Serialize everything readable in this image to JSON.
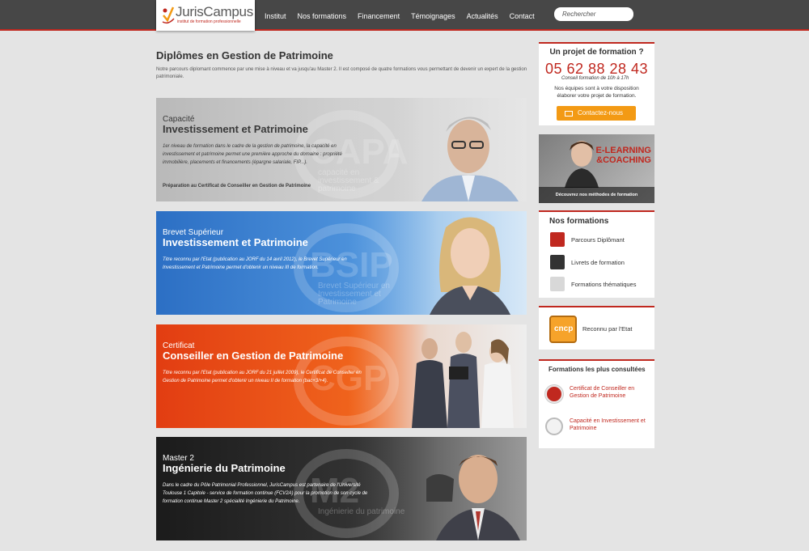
{
  "header": {
    "brand": "JurisCampus",
    "tagline": "institut de formation professionnelle",
    "nav": [
      "Institut",
      "Nos formations",
      "Financement",
      "Témoignages",
      "Actualités",
      "Contact"
    ],
    "search_placeholder": "Rechercher"
  },
  "page": {
    "title": "Diplômes en Gestion de Patrimoine",
    "intro": "Notre parcours diplomant commence par une mise à niveau et va jusqu'au Master 2. Il est composé de quatre formations vous permettant de devenir un expert de la gestion patrimoniale."
  },
  "banners": [
    {
      "sub": "Capacité",
      "main": "Investissement et Patrimoine",
      "desc": "1er niveau de formation dans le cadre de la gestion de patrimoine, la capacité en investissement et patrimoine permet une première approche du domaine : propriété immobilière, placements et financements (épargne salariale, FIP...).",
      "extra": "Préparation au Certificat de Conseiller en Gestion de Patrimoine",
      "ghost": "CAPA",
      "ghost_sub": "capacité en investissement & patrimoine"
    },
    {
      "sub": "Brevet Supérieur",
      "main": "Investissement et Patrimoine",
      "desc": "Titre reconnu par l'Etat (publication au JORF du 14 avril 2012), le Brevet Supérieur en Investissement et Patrimoine permet d'obtenir un niveau III de formation.",
      "ghost": "BSIP",
      "ghost_sub": "Brevet Supérieur en Investissement et Patrimoine"
    },
    {
      "sub": "Certificat",
      "main": "Conseiller en Gestion de Patrimoine",
      "desc": "Titre reconnu par l'Etat (publication au JORF du 21 juillet 2009), le Certificat de Conseiller en Gestion de Patrimoine permet d'obtenir un niveau II de formation (bac+3/+4).",
      "ghost": "CGP",
      "ghost_sub": ""
    },
    {
      "sub": "Master 2",
      "main": "Ingénierie du Patrimoine",
      "desc": "Dans le cadre du Pôle Patrimonial Professionnel, JurisCampus est partenaire de l'Université Toulouse 1 Capitole - service de formation continue (FCV2A) pour la promotion de son cycle de formation continue Master 2 spécialité Ingénierie du Patrimoine.",
      "ghost": "M2",
      "ghost_sub": "Ingénierie du patrimoine"
    }
  ],
  "sidebar": {
    "project": {
      "title": "Un projet de formation ?",
      "phone": "05 62 88 28 43",
      "hours": "Conseil formation de 10h à 17h",
      "text": "Nos équipes sont à votre disposition élaborer votre projet de formation.",
      "button": "Contactez-nous"
    },
    "elearning": {
      "line1": "E-LEARNING",
      "line2": "&COACHING",
      "caption": "Découvrez nos méthodes de formation"
    },
    "formations": {
      "title": "Nos formations",
      "items": [
        "Parcours Diplômant",
        "Livrets de formation",
        "Formations thématiques"
      ]
    },
    "cncp": {
      "badge": "cncp",
      "label": "Reconnu par l'Etat"
    },
    "most": {
      "title": "Formations les plus consultées",
      "items": [
        {
          "badge": "CGP",
          "label": "Certificat de Conseiller en Gestion de Patrimoine"
        },
        {
          "badge": "CAPA",
          "label": "Capacité en Investissement et Patrimoine"
        }
      ]
    }
  },
  "colors": {
    "accent": "#c0281f",
    "header": "#474747",
    "button": "#f39a14"
  }
}
